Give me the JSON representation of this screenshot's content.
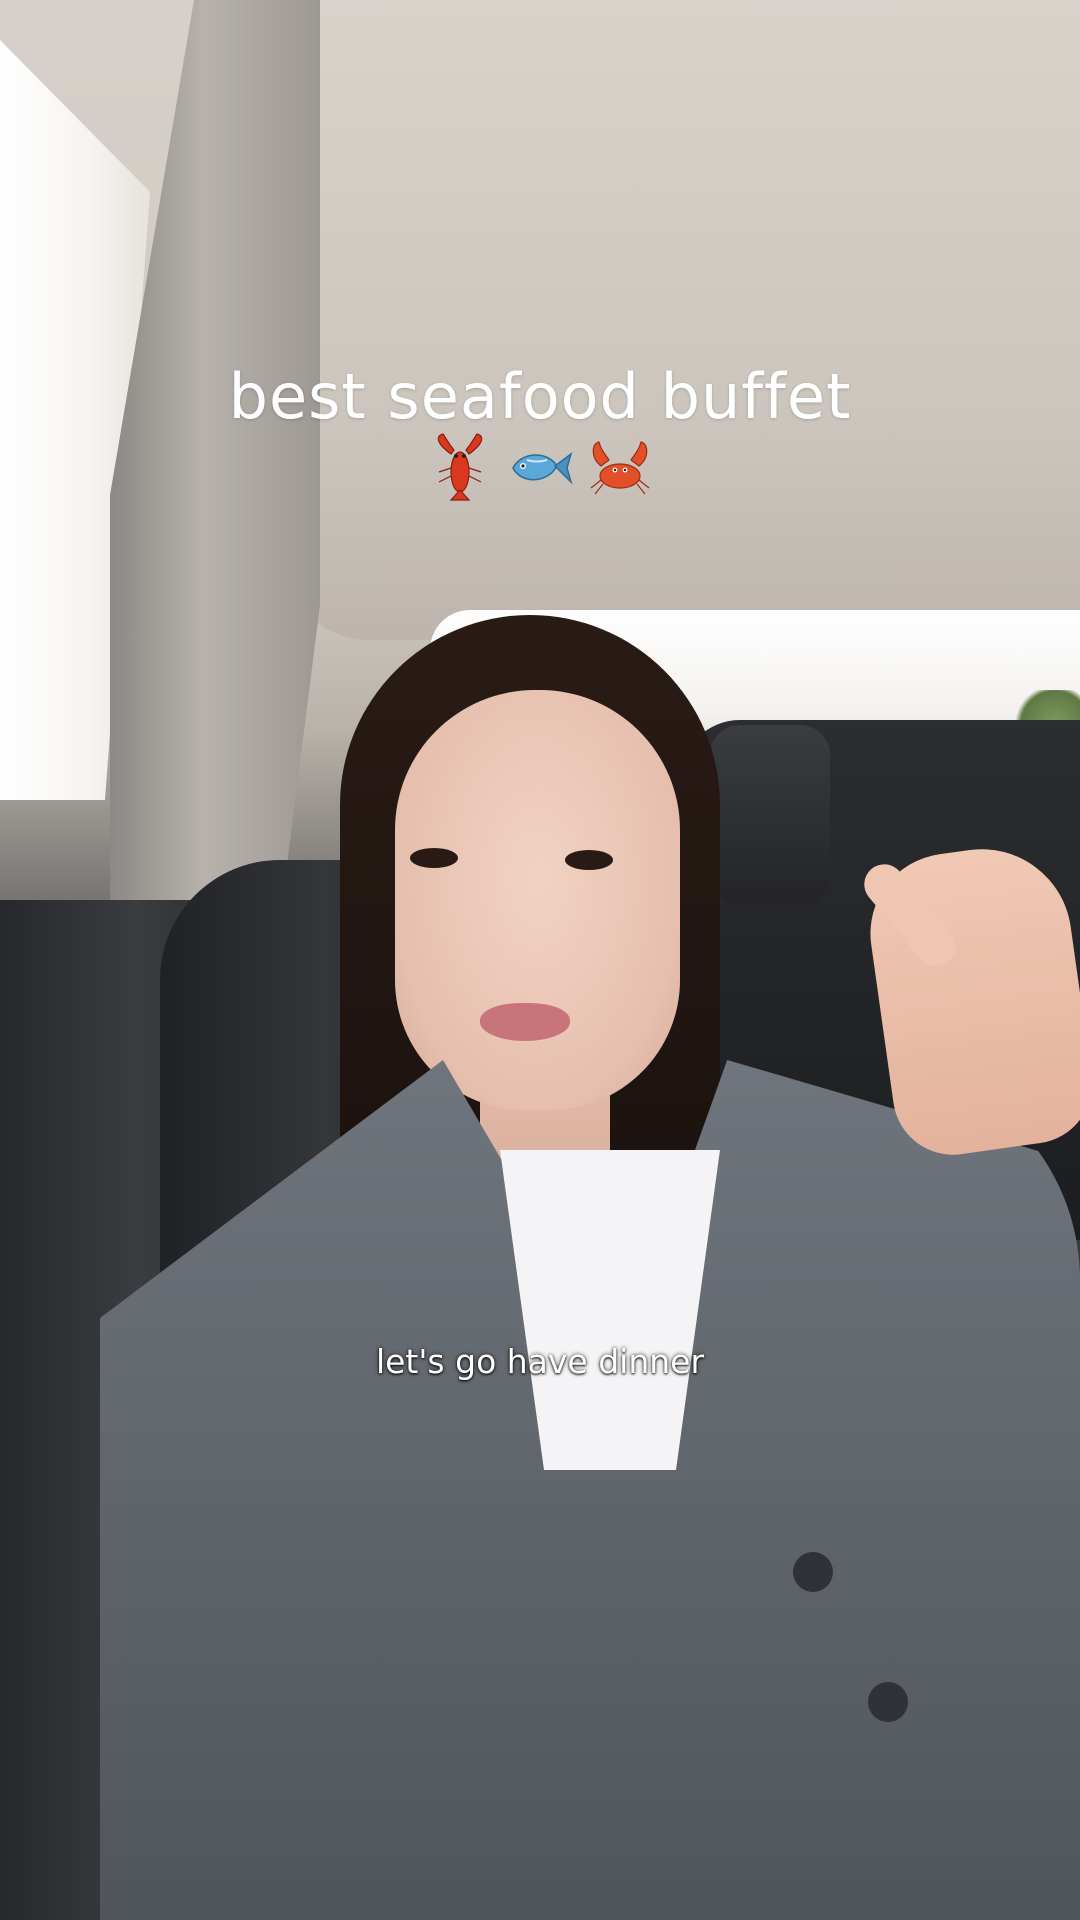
{
  "overlay": {
    "title": "best seafood buffet",
    "emojis": [
      "lobster-icon",
      "fish-icon",
      "crab-icon"
    ],
    "caption": "let's go have dinner"
  },
  "colors": {
    "overlay_text": "#ffffff",
    "lobster": "#d9381e",
    "fish": "#5aa7d8",
    "crab": "#e2502a"
  }
}
